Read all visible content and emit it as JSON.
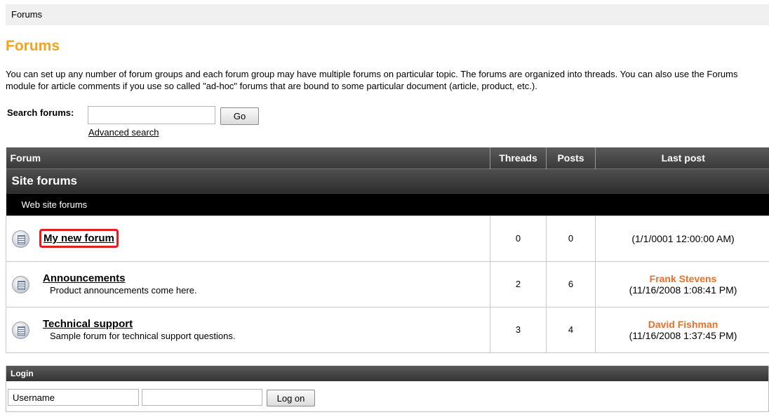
{
  "breadcrumb": "Forums",
  "page_title": "Forums",
  "intro": "You can set up any number of forum groups and each forum group may have multiple forums on particular topic. The forums are organized into threads. You can also use the Forums module for article comments if you use so called \"ad-hoc\" forums that are bound to some particular document (article, product, etc.).",
  "search": {
    "label": "Search forums:",
    "value": "",
    "go_label": "Go",
    "advanced_link": "Advanced search"
  },
  "table": {
    "headers": {
      "forum": "Forum",
      "threads": "Threads",
      "posts": "Posts",
      "last_post": "Last post"
    },
    "group": {
      "name": "Site forums",
      "description": "Web site forums"
    },
    "rows": [
      {
        "name": "My new forum",
        "description": "",
        "threads": "0",
        "posts": "0",
        "last_poster": "",
        "last_date": "(1/1/0001 12:00:00 AM)"
      },
      {
        "name": "Announcements",
        "description": "Product announcements come here.",
        "threads": "2",
        "posts": "6",
        "last_poster": "Frank Stevens",
        "last_date": "(11/16/2008 1:08:41 PM)"
      },
      {
        "name": "Technical support",
        "description": "Sample forum for technical support questions.",
        "threads": "3",
        "posts": "4",
        "last_poster": "David Fishman",
        "last_date": "(11/16/2008 1:37:45 PM)"
      }
    ]
  },
  "login": {
    "title": "Login",
    "username_value": "Username",
    "password_value": "",
    "logon_label": "Log on"
  },
  "icons": {
    "forum_row": "forum-document-icon"
  },
  "colors": {
    "title_accent": "#f7a21b",
    "poster_name": "#e8702a",
    "highlight_border": "#e0201e"
  }
}
